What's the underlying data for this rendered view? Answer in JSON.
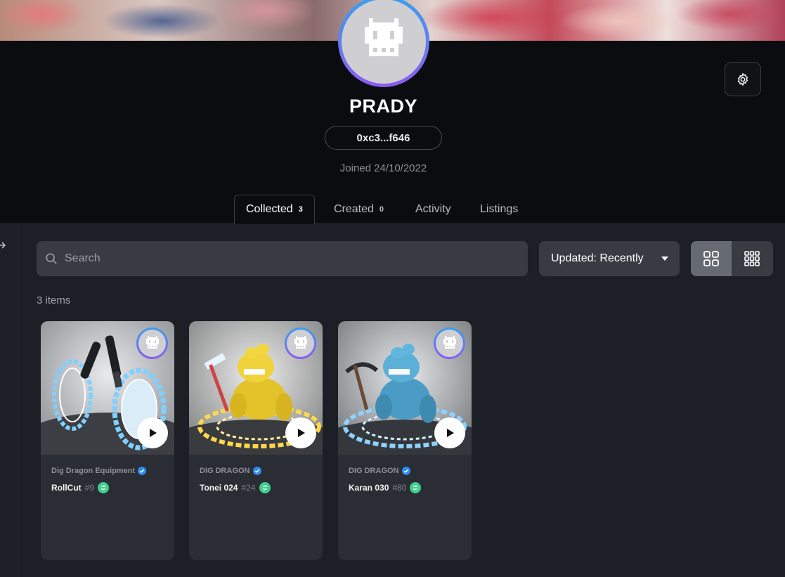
{
  "profile": {
    "username": "PRADY",
    "address": "0xc3...f646",
    "joined": "Joined 24/10/2022"
  },
  "tabs": [
    {
      "label": "Collected",
      "count": "3",
      "active": true
    },
    {
      "label": "Created",
      "count": "0",
      "active": false
    },
    {
      "label": "Activity",
      "count": "",
      "active": false
    },
    {
      "label": "Listings",
      "count": "",
      "active": false
    }
  ],
  "toolbar": {
    "search_placeholder": "Search",
    "sort_label": "Updated: Recently",
    "view_modes": [
      "large-grid-icon",
      "small-grid-icon"
    ],
    "active_view": "large-grid-icon"
  },
  "items_count": "3 items",
  "cards": [
    {
      "collection": "Dig Dragon Equipment",
      "name": "RollCut",
      "number": "#9",
      "theme": "equipment"
    },
    {
      "collection": "DIG DRAGON",
      "name": "Tonei 024",
      "number": "#24",
      "theme": "yellow"
    },
    {
      "collection": "DIG DRAGON",
      "name": "Karan 030",
      "number": "#80",
      "theme": "blue"
    }
  ],
  "colors": {
    "background": "#0b0c0f",
    "panel": "#1c1f25",
    "card": "#2a2d33",
    "verified": "#2d8cf0",
    "chain_badge": "#3fcf8e",
    "avatar_ring_top": "#3aa0f0",
    "avatar_ring_bottom": "#8a5cf0"
  }
}
